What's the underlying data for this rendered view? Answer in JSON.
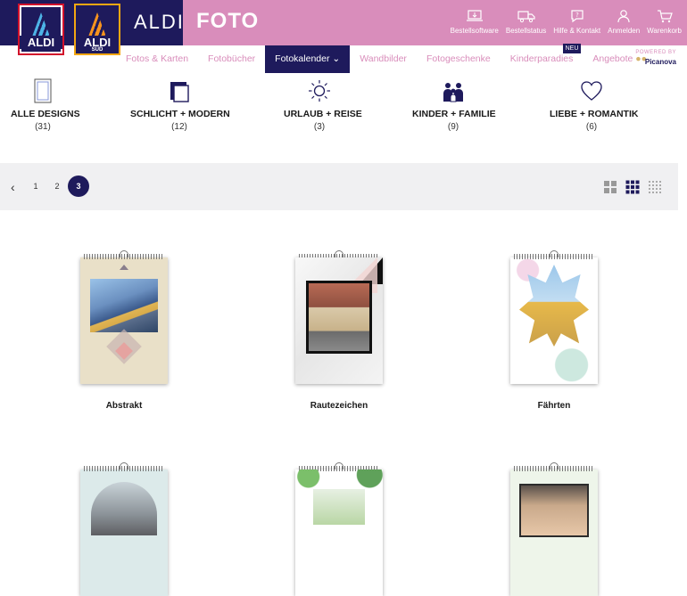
{
  "header": {
    "logo1_text": "ALDI",
    "logo2_text": "ALDI",
    "logo2_sub": "SÜD",
    "brand": "ALDI",
    "section": "FOTO",
    "links": [
      {
        "label": "Bestellsoftware",
        "icon": "laptop-icon"
      },
      {
        "label": "Bestellstatus",
        "icon": "truck-icon"
      },
      {
        "label": "Hilfe & Kontakt",
        "icon": "chat-icon"
      },
      {
        "label": "Anmelden",
        "icon": "user-icon"
      },
      {
        "label": "Warenkorb",
        "icon": "cart-icon"
      }
    ]
  },
  "nav": {
    "items": [
      "Fotos & Karten",
      "Fotobücher",
      "Fotokalender",
      "Wandbilder",
      "Fotogeschenke",
      "Kinderparadies",
      "Angebote"
    ],
    "badge": "NEU",
    "powered_by": "POWERED BY",
    "powered_brand": "Picanova"
  },
  "categories": [
    {
      "name": "ALLE DESIGNS",
      "count": "(31)",
      "icon": "frame-icon"
    },
    {
      "name": "SCHLICHT + MODERN",
      "count": "(12)",
      "icon": "layers-icon"
    },
    {
      "name": "URLAUB + REISE",
      "count": "(3)",
      "icon": "sun-icon"
    },
    {
      "name": "KINDER + FAMILIE",
      "count": "(9)",
      "icon": "family-icon"
    },
    {
      "name": "LIEBE + ROMANTIK",
      "count": "(6)",
      "icon": "heart-icon"
    }
  ],
  "pagination": {
    "pages": [
      "1",
      "2",
      "3"
    ],
    "current": "3"
  },
  "products": [
    {
      "title": "Abstrakt"
    },
    {
      "title": "Rautezeichen"
    },
    {
      "title": "Fährten"
    }
  ],
  "colors": {
    "brand_pink": "#d98dbb",
    "brand_navy": "#1e1a5c"
  }
}
